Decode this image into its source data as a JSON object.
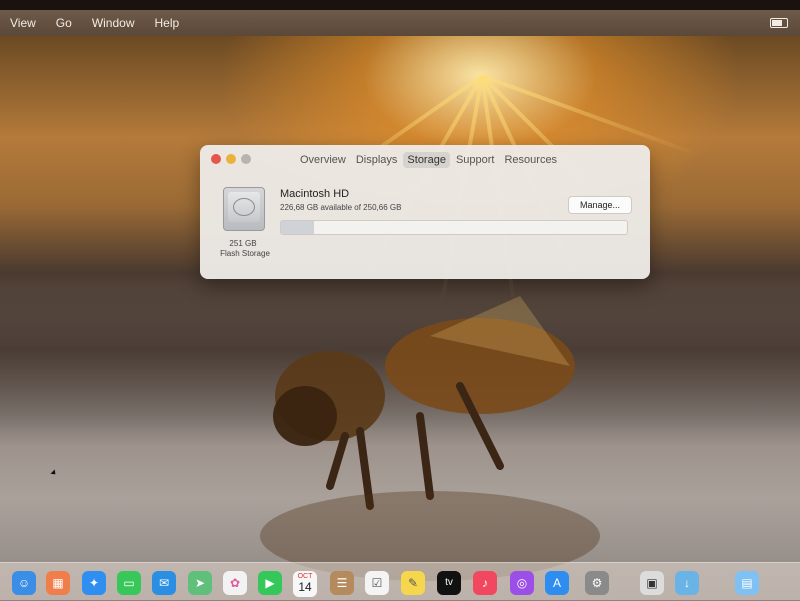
{
  "menubar": {
    "items": [
      "View",
      "Go",
      "Window",
      "Help"
    ]
  },
  "about_window": {
    "tabs": [
      "Overview",
      "Displays",
      "Storage",
      "Support",
      "Resources"
    ],
    "active_tab": "Storage",
    "disk": {
      "capacity_label": "251 GB",
      "type_label": "Flash Storage",
      "name": "Macintosh HD",
      "availability": "226,68 GB available of 250,66 GB",
      "used_fraction": 0.096
    },
    "manage_label": "Manage..."
  },
  "dock": {
    "calendar_month": "OCT",
    "calendar_day": "14",
    "tv_label": "tv"
  },
  "colors": {
    "close": "#e5564b",
    "minimize": "#e9b23a",
    "zoom_disabled": "#b7b3ae"
  }
}
